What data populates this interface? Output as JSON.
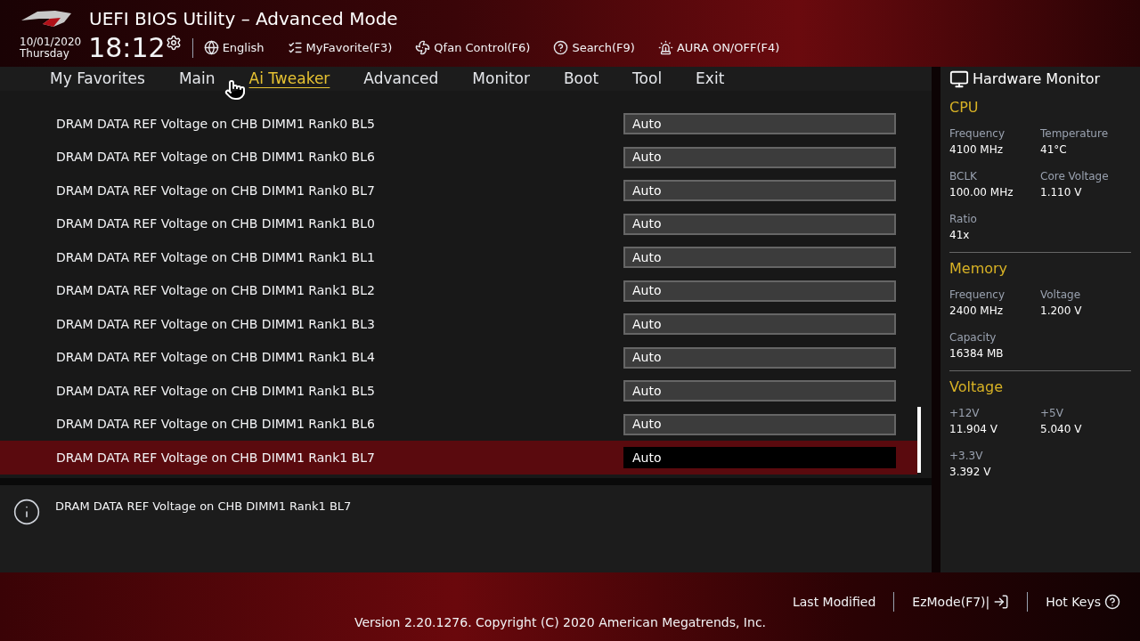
{
  "header": {
    "title": "UEFI BIOS Utility – Advanced Mode",
    "date": "10/01/2020",
    "day": "Thursday",
    "time": "18:12",
    "toolbar": [
      {
        "kind": "language",
        "label": "English"
      },
      {
        "kind": "favorite",
        "label": "MyFavorite(F3)"
      },
      {
        "kind": "fan",
        "label": "Qfan Control(F6)"
      },
      {
        "kind": "search",
        "label": "Search(F9)"
      },
      {
        "kind": "aura",
        "label": "AURA ON/OFF(F4)"
      }
    ]
  },
  "tabs": [
    {
      "label": "My Favorites",
      "selected": false
    },
    {
      "label": "Main",
      "selected": false
    },
    {
      "label": "Ai Tweaker",
      "selected": true
    },
    {
      "label": "Advanced",
      "selected": false
    },
    {
      "label": "Monitor",
      "selected": false
    },
    {
      "label": "Boot",
      "selected": false
    },
    {
      "label": "Tool",
      "selected": false
    },
    {
      "label": "Exit",
      "selected": false
    }
  ],
  "settings": [
    {
      "label": "DRAM DATA REF Voltage on CHB DIMM1 Rank0 BL5",
      "value": "Auto",
      "selected": false
    },
    {
      "label": "DRAM DATA REF Voltage on CHB DIMM1 Rank0 BL6",
      "value": "Auto",
      "selected": false
    },
    {
      "label": "DRAM DATA REF Voltage on CHB DIMM1 Rank0 BL7",
      "value": "Auto",
      "selected": false
    },
    {
      "label": "DRAM DATA REF Voltage on CHB DIMM1 Rank1 BL0",
      "value": "Auto",
      "selected": false
    },
    {
      "label": "DRAM DATA REF Voltage on CHB DIMM1 Rank1 BL1",
      "value": "Auto",
      "selected": false
    },
    {
      "label": "DRAM DATA REF Voltage on CHB DIMM1 Rank1 BL2",
      "value": "Auto",
      "selected": false
    },
    {
      "label": "DRAM DATA REF Voltage on CHB DIMM1 Rank1 BL3",
      "value": "Auto",
      "selected": false
    },
    {
      "label": "DRAM DATA REF Voltage on CHB DIMM1 Rank1 BL4",
      "value": "Auto",
      "selected": false
    },
    {
      "label": "DRAM DATA REF Voltage on CHB DIMM1 Rank1 BL5",
      "value": "Auto",
      "selected": false
    },
    {
      "label": "DRAM DATA REF Voltage on CHB DIMM1 Rank1 BL6",
      "value": "Auto",
      "selected": false
    },
    {
      "label": "DRAM DATA REF Voltage on CHB DIMM1 Rank1 BL7",
      "value": "Auto",
      "selected": true
    }
  ],
  "help_text": "DRAM DATA REF Voltage on CHB DIMM1 Rank1 BL7",
  "hardware_monitor": {
    "title": "Hardware Monitor",
    "sections": [
      {
        "title": "CPU",
        "items": [
          {
            "label": "Frequency",
            "value": "4100 MHz"
          },
          {
            "label": "Temperature",
            "value": "41°C"
          },
          {
            "label": "BCLK",
            "value": "100.00 MHz"
          },
          {
            "label": "Core Voltage",
            "value": "1.110 V"
          },
          {
            "label": "Ratio",
            "value": "41x"
          }
        ]
      },
      {
        "title": "Memory",
        "items": [
          {
            "label": "Frequency",
            "value": "2400 MHz"
          },
          {
            "label": "Voltage",
            "value": "1.200 V"
          },
          {
            "label": "Capacity",
            "value": "16384 MB"
          }
        ]
      },
      {
        "title": "Voltage",
        "items": [
          {
            "label": "+12V",
            "value": "11.904 V"
          },
          {
            "label": "+5V",
            "value": "5.040 V"
          },
          {
            "label": "+3.3V",
            "value": "3.392 V"
          }
        ]
      }
    ]
  },
  "footer": {
    "links": [
      {
        "kind": "last",
        "label": "Last Modified"
      },
      {
        "kind": "ezmode",
        "label": "EzMode(F7)|"
      },
      {
        "kind": "hotkeys",
        "label": "Hot Keys"
      }
    ],
    "copyright": "Version 2.20.1276. Copyright (C) 2020 American Megatrends, Inc."
  }
}
